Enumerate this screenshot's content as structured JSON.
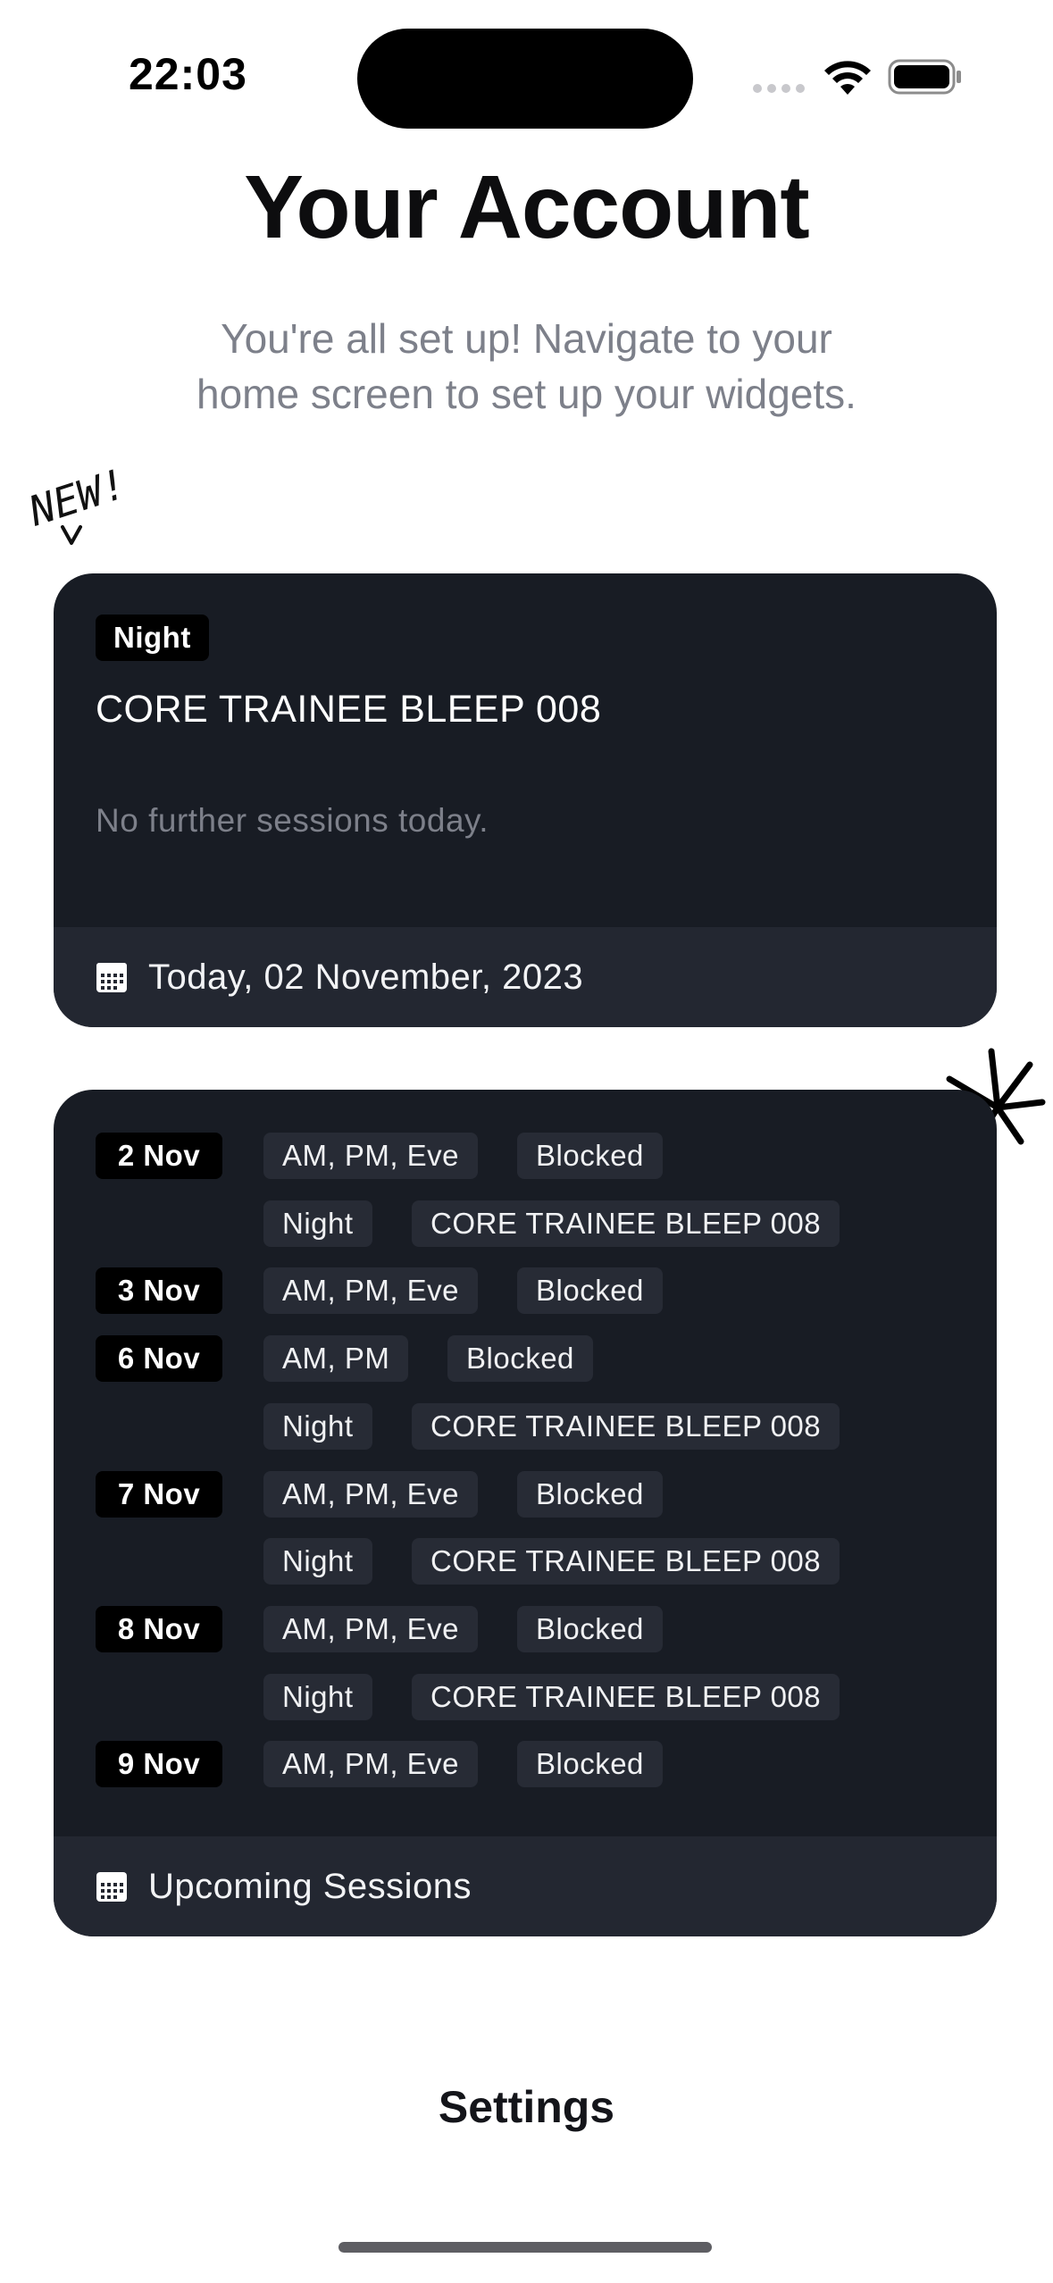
{
  "status_bar": {
    "time": "22:03"
  },
  "page": {
    "title": "Your Account",
    "subtitle_line1": "You're all set up! Navigate to your",
    "subtitle_line2": "home screen to set up your widgets.",
    "new_annotation": "NEW!"
  },
  "today_widget": {
    "badge": "Night",
    "session_name": "CORE TRAINEE BLEEP 008",
    "empty_message": "No further sessions today.",
    "footer_label": "Today, 02 November, 2023",
    "footer_icon": "calendar-icon"
  },
  "upcoming_widget": {
    "footer_label": "Upcoming Sessions",
    "footer_icon": "calendar-icon",
    "rows": [
      {
        "date": "2 Nov",
        "time": "AM, PM, Eve",
        "detail": "Blocked"
      },
      {
        "date": "",
        "time": "Night",
        "detail": "CORE TRAINEE BLEEP 008"
      },
      {
        "date": "3 Nov",
        "time": "AM, PM, Eve",
        "detail": "Blocked"
      },
      {
        "date": "6 Nov",
        "time": "AM, PM",
        "detail": "Blocked"
      },
      {
        "date": "",
        "time": "Night",
        "detail": "CORE TRAINEE BLEEP 008"
      },
      {
        "date": "7 Nov",
        "time": "AM, PM, Eve",
        "detail": "Blocked"
      },
      {
        "date": "",
        "time": "Night",
        "detail": "CORE TRAINEE BLEEP 008"
      },
      {
        "date": "8 Nov",
        "time": "AM, PM, Eve",
        "detail": "Blocked"
      },
      {
        "date": "",
        "time": "Night",
        "detail": "CORE TRAINEE BLEEP 008"
      },
      {
        "date": "9 Nov",
        "time": "AM, PM, Eve",
        "detail": "Blocked"
      }
    ]
  },
  "settings_label": "Settings",
  "colors": {
    "card_bg": "#181c24",
    "card_footer_bg": "#232731",
    "tag_bg": "#272b35",
    "date_bg": "#000000",
    "subtitle": "#7d808a"
  }
}
